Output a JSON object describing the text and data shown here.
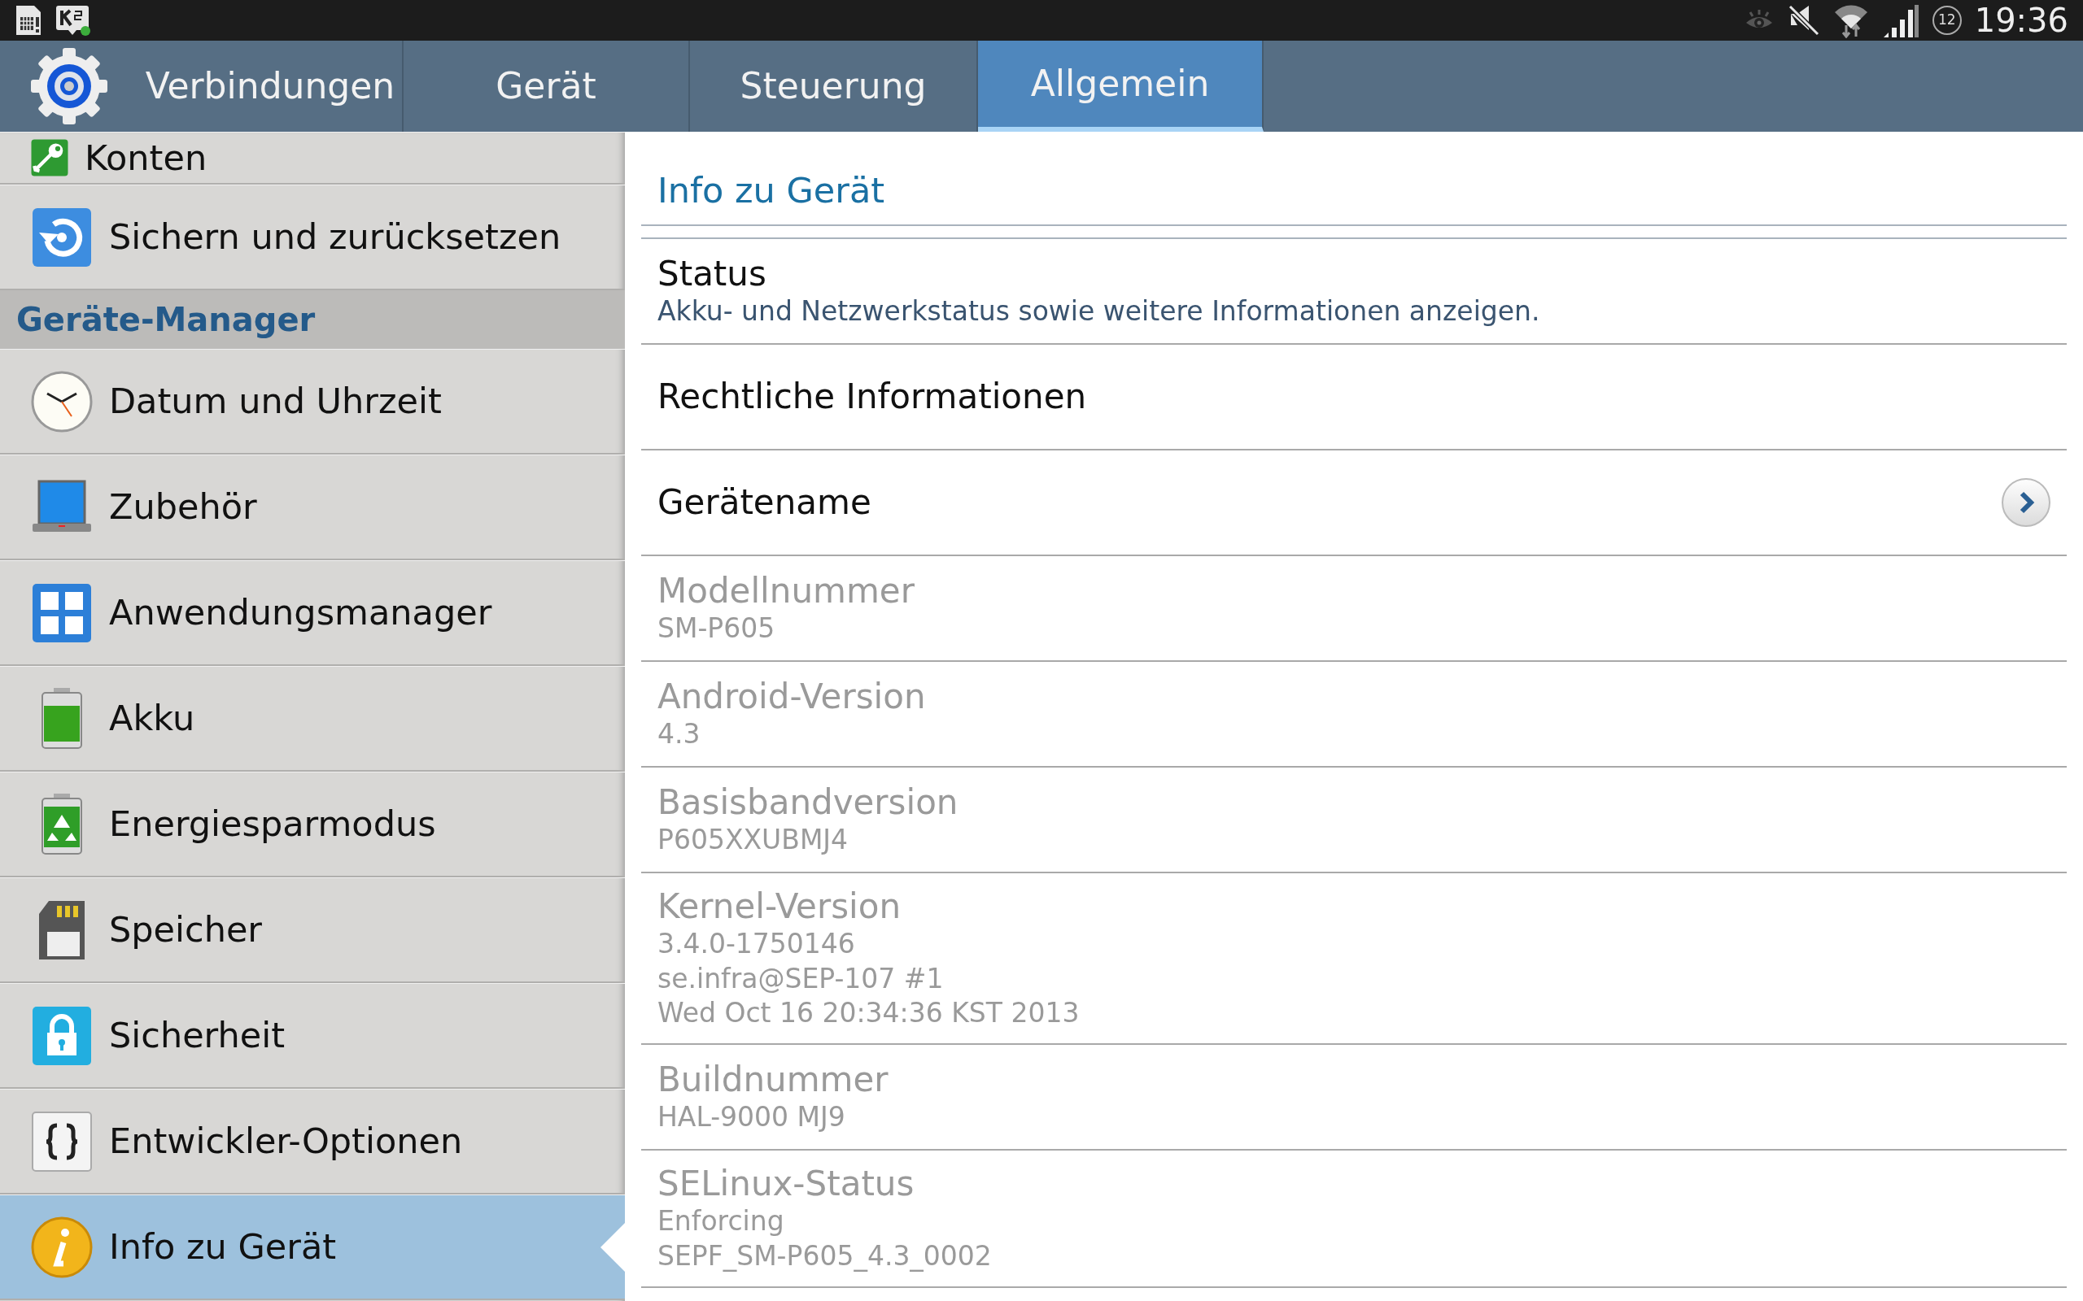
{
  "status_bar": {
    "notification_count": "12",
    "time": "19:36"
  },
  "tabs": [
    {
      "label": "Verbindungen",
      "selected": false
    },
    {
      "label": "Gerät",
      "selected": false
    },
    {
      "label": "Steuerung",
      "selected": false
    },
    {
      "label": "Allgemein",
      "selected": true
    }
  ],
  "sidebar": {
    "items": [
      {
        "kind": "item",
        "label": "Konten",
        "selected": false
      },
      {
        "kind": "item",
        "label": "Sichern und zurücksetzen",
        "selected": false
      },
      {
        "kind": "header",
        "label": "Geräte-Manager"
      },
      {
        "kind": "item",
        "label": "Datum und Uhrzeit",
        "selected": false
      },
      {
        "kind": "item",
        "label": "Zubehör",
        "selected": false
      },
      {
        "kind": "item",
        "label": "Anwendungsmanager",
        "selected": false
      },
      {
        "kind": "item",
        "label": "Akku",
        "selected": false
      },
      {
        "kind": "item",
        "label": "Energiesparmodus",
        "selected": false
      },
      {
        "kind": "item",
        "label": "Speicher",
        "selected": false
      },
      {
        "kind": "item",
        "label": "Sicherheit",
        "selected": false
      },
      {
        "kind": "item",
        "label": "Entwickler-Optionen",
        "selected": false
      },
      {
        "kind": "item",
        "label": "Info zu Gerät",
        "selected": true
      }
    ]
  },
  "content": {
    "title": "Info zu Gerät",
    "rows": [
      {
        "title": "Status",
        "lines": [
          "Akku- und Netzwerkstatus sowie weitere Informationen anzeigen."
        ],
        "disabled": false
      },
      {
        "title": "Rechtliche Informationen",
        "disabled": false
      },
      {
        "title": "Gerätename",
        "disabled": false,
        "kind": "chevron"
      },
      {
        "title": "Modellnummer",
        "lines": [
          "SM-P605"
        ],
        "disabled": true
      },
      {
        "title": "Android-Version",
        "lines": [
          "4.3"
        ],
        "disabled": true
      },
      {
        "title": "Basisbandversion",
        "lines": [
          "P605XXUBMJ4"
        ],
        "disabled": true
      },
      {
        "title": "Kernel-Version",
        "lines": [
          "3.4.0-1750146",
          "se.infra@SEP-107 #1",
          "Wed Oct 16 20:34:36 KST 2013"
        ],
        "disabled": true
      },
      {
        "title": "Buildnummer",
        "lines": [
          "HAL-9000 MJ9"
        ],
        "disabled": true
      },
      {
        "title": "SELinux-Status",
        "lines": [
          "Enforcing",
          "SEPF_SM-P605_4.3_0002"
        ],
        "disabled": true
      }
    ]
  }
}
